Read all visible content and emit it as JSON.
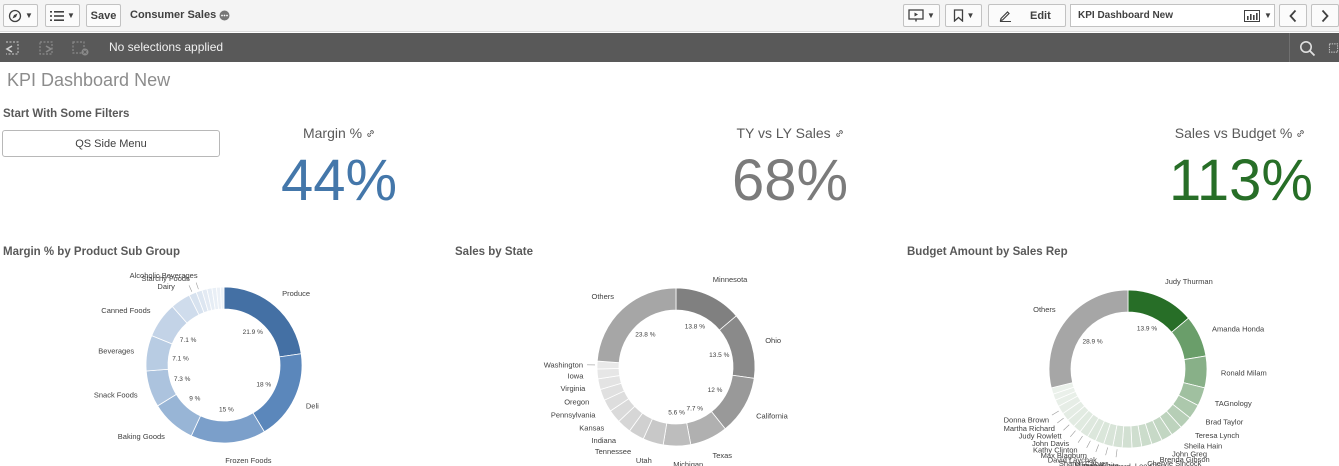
{
  "toolbar": {
    "save_label": "Save",
    "app_title": "Consumer Sales",
    "edit_label": "Edit",
    "sheet_name": "KPI Dashboard New"
  },
  "selection_bar": {
    "status": "No selections applied"
  },
  "sheet": {
    "title": "KPI Dashboard New"
  },
  "filters": {
    "title": "Start With Some Filters",
    "button_label": "QS Side Menu"
  },
  "kpis": [
    {
      "label": "Margin %",
      "value": "44%",
      "color": "#4477aa"
    },
    {
      "label": "TY vs LY Sales",
      "value": "68%",
      "color": "#7b7b7b"
    },
    {
      "label": "Sales vs Budget %",
      "value": "113%",
      "color": "#276e27"
    }
  ],
  "colors": {
    "accent_blue": "#4477aa",
    "accent_grey": "#7b7b7b",
    "accent_green": "#276e27",
    "selection_bar": "#595959"
  },
  "chart_data": [
    {
      "type": "pie",
      "title": "Margin % by Product Sub Group",
      "segments": [
        {
          "label": "Produce",
          "value": 21.9,
          "pct": "21.9 %",
          "color": "#4470a4"
        },
        {
          "label": "Deli",
          "value": 18,
          "pct": "18 %",
          "color": "#5b87bb"
        },
        {
          "label": "Frozen Foods",
          "value": 15,
          "pct": "15 %",
          "color": "#7b9fca"
        },
        {
          "label": "Baking Goods",
          "value": 9,
          "pct": "9 %",
          "color": "#98b5d6"
        },
        {
          "label": "Snack Foods",
          "value": 7.3,
          "pct": "7.3 %",
          "color": "#acc3de"
        },
        {
          "label": "Beverages",
          "value": 7.1,
          "pct": "7.1 %",
          "color": "#b8cce3"
        },
        {
          "label": "Canned Foods",
          "value": 7.1,
          "pct": "7.1 %",
          "color": "#c3d3e7"
        },
        {
          "label": "Dairy",
          "value": 4,
          "pct": "",
          "color": "#cfdcec"
        },
        {
          "label": "Starchy Foods",
          "value": 1.5,
          "pct": "",
          "color": "#d7e2ef"
        },
        {
          "label": "Alcoholic Beverages",
          "value": 1.2,
          "pct": "",
          "color": "#dde6f1"
        },
        {
          "label": "",
          "value": 1.0,
          "pct": "",
          "color": "#e3eaf3"
        },
        {
          "label": "",
          "value": 1.0,
          "pct": "",
          "color": "#e6edf5"
        },
        {
          "label": "",
          "value": 0.9,
          "pct": "",
          "color": "#e9eff6"
        },
        {
          "label": "",
          "value": 0.8,
          "pct": "",
          "color": "#ecf1f7"
        },
        {
          "label": "",
          "value": 0.7,
          "pct": "",
          "color": "#eef3f8"
        }
      ]
    },
    {
      "type": "pie",
      "title": "Sales by State",
      "segments": [
        {
          "label": "Minnesota",
          "value": 13.8,
          "pct": "13.8 %",
          "color": "#808080"
        },
        {
          "label": "Ohio",
          "value": 13.5,
          "pct": "13.5 %",
          "color": "#8a8a8a"
        },
        {
          "label": "California",
          "value": 12,
          "pct": "12 %",
          "color": "#999999"
        },
        {
          "label": "Texas",
          "value": 7.7,
          "pct": "7.7 %",
          "color": "#b0b0b0"
        },
        {
          "label": "Michigan",
          "value": 5.6,
          "pct": "5.6 %",
          "color": "#bdbdbd"
        },
        {
          "label": "Utah",
          "value": 4.2,
          "pct": "",
          "color": "#c8c8c8"
        },
        {
          "label": "Tennessee",
          "value": 3.2,
          "pct": "",
          "color": "#d0d0d0"
        },
        {
          "label": "Indiana",
          "value": 2.9,
          "pct": "",
          "color": "#d6d6d6"
        },
        {
          "label": "Kansas",
          "value": 2.7,
          "pct": "",
          "color": "#dadada"
        },
        {
          "label": "Pennsylvania",
          "value": 2.5,
          "pct": "",
          "color": "#dddddd"
        },
        {
          "label": "Oregon",
          "value": 2.3,
          "pct": "",
          "color": "#e0e0e0"
        },
        {
          "label": "Virginia",
          "value": 2.2,
          "pct": "",
          "color": "#e3e3e3"
        },
        {
          "label": "Iowa",
          "value": 2.0,
          "pct": "",
          "color": "#e6e6e6"
        },
        {
          "label": "Washington",
          "value": 1.6,
          "pct": "",
          "color": "#e9e9e9"
        },
        {
          "label": "Others",
          "value": 23.8,
          "pct": "23.8 %",
          "color": "#a6a6a6"
        }
      ]
    },
    {
      "type": "pie",
      "title": "Budget Amount by Sales Rep",
      "segments": [
        {
          "label": "Judy Thurman",
          "value": 13.9,
          "pct": "13.9 %",
          "color": "#276e27"
        },
        {
          "label": "Amanda Honda",
          "value": 8.5,
          "pct": "",
          "color": "#6a9e6a"
        },
        {
          "label": "Ronald Milam",
          "value": 6.5,
          "pct": "",
          "color": "#88b088"
        },
        {
          "label": "TAGnology",
          "value": 3.8,
          "pct": "",
          "color": "#a0c0a0"
        },
        {
          "label": "Brad Taylor",
          "value": 3.0,
          "pct": "",
          "color": "#acc8ac"
        },
        {
          "label": "Teresa Lynch",
          "value": 2.6,
          "pct": "",
          "color": "#b6ceb6"
        },
        {
          "label": "Sheila Hain",
          "value": 2.4,
          "pct": "",
          "color": "#bdd3bd"
        },
        {
          "label": "John Greg",
          "value": 2.3,
          "pct": "",
          "color": "#c2d6c2"
        },
        {
          "label": "Brenda Gibson",
          "value": 2.2,
          "pct": "",
          "color": "#c7d9c7"
        },
        {
          "label": "Cheryle Sincock",
          "value": 2.1,
          "pct": "",
          "color": "#cbdccb"
        },
        {
          "label": "Lee Chin",
          "value": 2.0,
          "pct": "",
          "color": "#cfdecf"
        },
        {
          "label": "David Howard",
          "value": 2.0,
          "pct": "",
          "color": "#d2e0d2"
        },
        {
          "label": "Marian White",
          "value": 1.9,
          "pct": "",
          "color": "#d5e2d5"
        },
        {
          "label": "Sharon Carver",
          "value": 1.9,
          "pct": "",
          "color": "#d8e4d8"
        },
        {
          "label": "David Laychak",
          "value": 1.8,
          "pct": "",
          "color": "#dae6da"
        },
        {
          "label": "Max Blagburn",
          "value": 1.8,
          "pct": "",
          "color": "#dce7dc"
        },
        {
          "label": "Kathy Clinton",
          "value": 1.8,
          "pct": "",
          "color": "#dee8de"
        },
        {
          "label": "John Davis",
          "value": 1.7,
          "pct": "",
          "color": "#e0eae0"
        },
        {
          "label": "Judy Rowlett",
          "value": 1.7,
          "pct": "",
          "color": "#e2ebe2"
        },
        {
          "label": "Martha Richard",
          "value": 1.7,
          "pct": "",
          "color": "#e4ece4"
        },
        {
          "label": "Donna Brown",
          "value": 1.7,
          "pct": "",
          "color": "#e6ede6"
        },
        {
          "label": "",
          "value": 1.4,
          "pct": "",
          "color": "#e8efe8"
        },
        {
          "label": "",
          "value": 1.3,
          "pct": "",
          "color": "#eaf0ea"
        },
        {
          "label": "",
          "value": 1.3,
          "pct": "",
          "color": "#ebf1eb"
        },
        {
          "label": "Others",
          "value": 28.9,
          "pct": "28.9 %",
          "color": "#a6a6a6"
        }
      ]
    }
  ]
}
